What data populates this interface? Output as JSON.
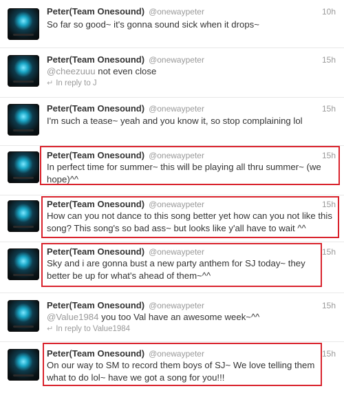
{
  "account": {
    "display_name": "Peter(Team Onesound)",
    "handle": "@onewaypeter"
  },
  "tweets": [
    {
      "time": "10h",
      "text": "So far so good~ it's gonna sound sick when it drops~"
    },
    {
      "time": "15h",
      "mention": "@cheezuuu",
      "text": " not even close",
      "reply": "In reply to J"
    },
    {
      "time": "15h",
      "text": "I'm such a tease~ yeah and you know it, so stop complaining lol"
    },
    {
      "time": "15h",
      "text": "In perfect time for summer~ this will be playing all thru summer~ (we hope)^^"
    },
    {
      "time": "15h",
      "text": "How can you not dance to this song better yet how can you not like this song? This song's so bad ass~ but looks like y'all have to wait ^^"
    },
    {
      "time": "15h",
      "text": "Sky and i are gonna bust a new party anthem for SJ today~ they better be up for what's ahead of them~^^"
    },
    {
      "time": "15h",
      "mention": "@Value1984",
      "text": " you too Val have an awesome week~^^",
      "reply": "In reply to Value1984"
    },
    {
      "time": "15h",
      "text": "On our way to SM to record them boys of SJ~ We love telling them what to do lol~ have we got a song for you!!!"
    }
  ],
  "highlight_color": "#d9212b"
}
